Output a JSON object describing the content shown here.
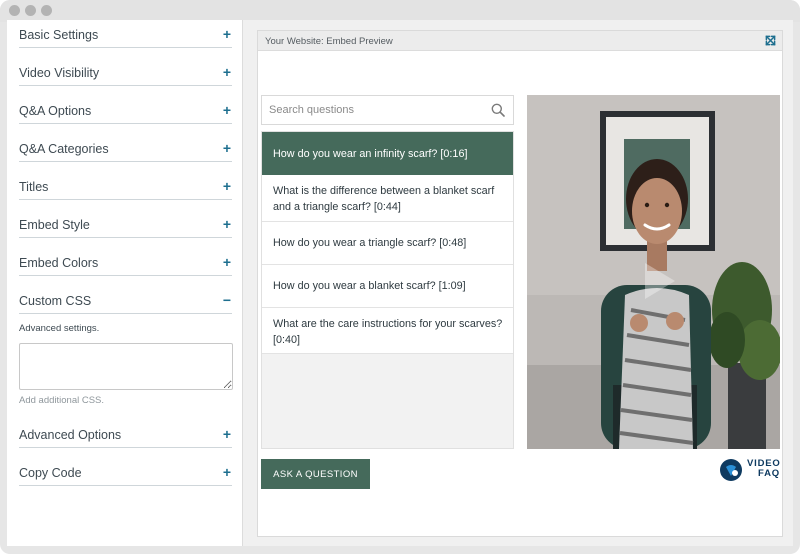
{
  "sidebar": {
    "items": [
      {
        "label": "Basic Settings",
        "toggle": "+"
      },
      {
        "label": "Video Visibility",
        "toggle": "+"
      },
      {
        "label": "Q&A Options",
        "toggle": "+"
      },
      {
        "label": "Q&A Categories",
        "toggle": "+"
      },
      {
        "label": "Titles",
        "toggle": "+"
      },
      {
        "label": "Embed Style",
        "toggle": "+"
      },
      {
        "label": "Embed Colors",
        "toggle": "+"
      },
      {
        "label": "Custom CSS",
        "toggle": "−"
      },
      {
        "label": "Advanced Options",
        "toggle": "+"
      },
      {
        "label": "Copy Code",
        "toggle": "+"
      }
    ],
    "custom_css": {
      "note": "Advanced settings.",
      "value": "",
      "hint": "Add additional CSS."
    }
  },
  "preview": {
    "title": "Your Website: Embed Preview",
    "search_placeholder": "Search questions",
    "questions": [
      {
        "text": "How do you wear an infinity scarf? [0:16]",
        "active": true
      },
      {
        "text": "What is the difference between a blanket scarf and a triangle scarf? [0:44]",
        "active": false
      },
      {
        "text": "How do you wear a triangle scarf? [0:48]",
        "active": false
      },
      {
        "text": "How do you wear a blanket scarf? [1:09]",
        "active": false
      },
      {
        "text": "What are the care instructions for your scarves? [0:40]",
        "active": false
      }
    ],
    "ask_button": "ASK A QUESTION",
    "logo_line1": "VIDEO",
    "logo_line2": "FAQ",
    "accent_color": "#456a5b",
    "brand_color": "#0e3a60"
  }
}
